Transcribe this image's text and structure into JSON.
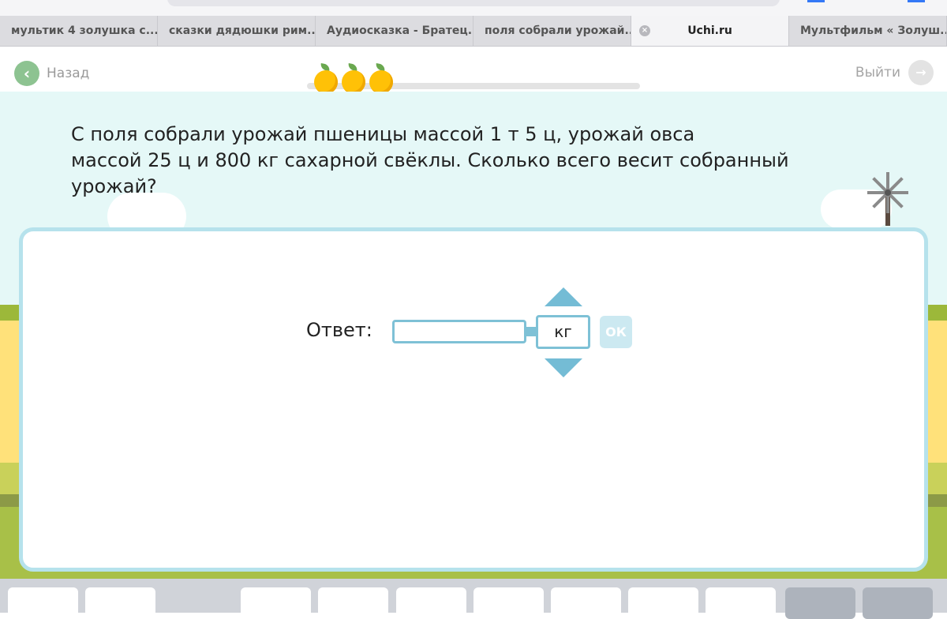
{
  "browser": {
    "tabs": [
      {
        "label": "мультик 4 золушка с..."
      },
      {
        "label": "сказки дядюшки рим..."
      },
      {
        "label": "Аудиосказка - Братец..."
      },
      {
        "label": "поля собрали урожай..."
      },
      {
        "label": "Uchi.ru",
        "active": true
      },
      {
        "label": "Мультфильм « Золуш..."
      }
    ],
    "close_icon": "×"
  },
  "header": {
    "back_label": "Назад",
    "exit_label": "Выйти",
    "apples_count": 3
  },
  "task": {
    "question": "С поля собрали урожай пшеницы массой 1 т 5 ц, урожай овса\nмассой 25 ц и 800 кг сахарной свёклы. Сколько всего весит собранный урожай?"
  },
  "answer": {
    "label": "Ответ:",
    "value": "",
    "unit": "кг",
    "ok_label": "ОК"
  },
  "colors": {
    "accent": "#7ec1d6",
    "back_green": "#8dc391",
    "apple": "#ffc107",
    "sky": "#e5f8f7"
  }
}
